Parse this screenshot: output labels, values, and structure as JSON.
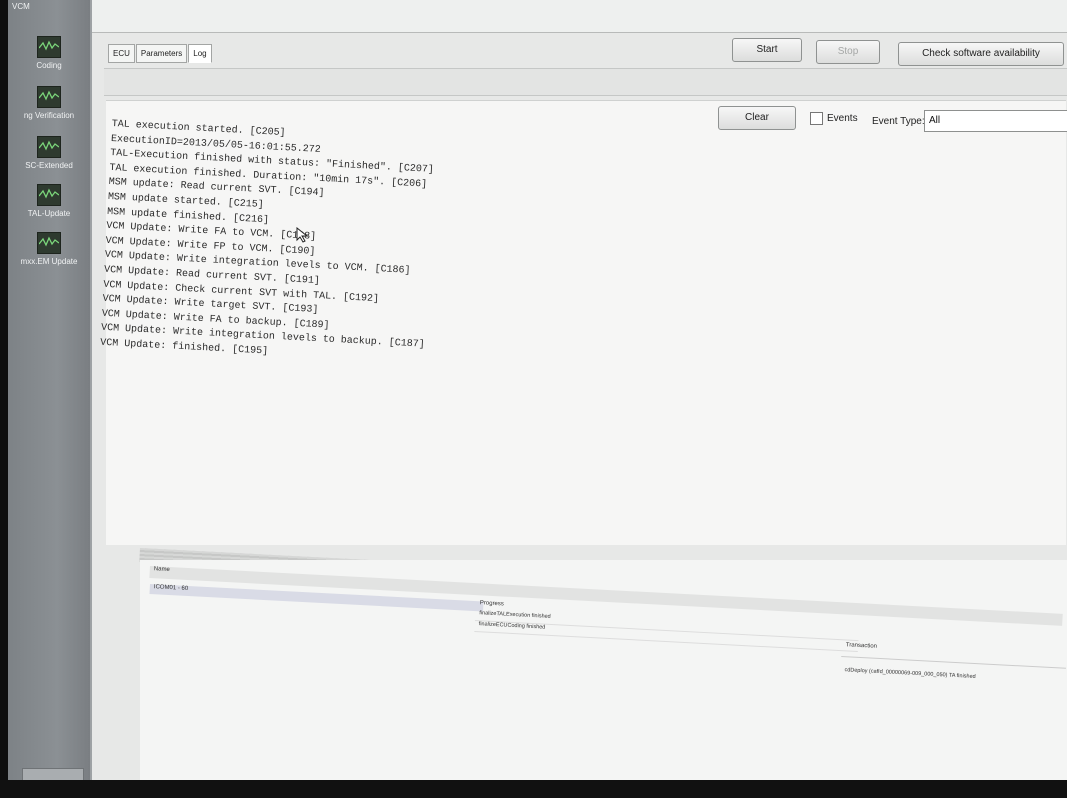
{
  "sidebar": {
    "items": [
      {
        "label": "VCM"
      },
      {
        "label": "Coding"
      },
      {
        "label": "ng Verification"
      },
      {
        "label": "SC-Extended"
      },
      {
        "label": "TAL-Update"
      },
      {
        "label": "mxx.EM Update"
      }
    ]
  },
  "tabs": [
    {
      "label": "ECU"
    },
    {
      "label": "Parameters"
    },
    {
      "label": "Log"
    }
  ],
  "toolbar": {
    "start_label": "Start",
    "stop_label": "Stop",
    "check_label": "Check software availability"
  },
  "log_toolbar": {
    "clear_label": "Clear",
    "events_label": "Events",
    "event_type_label": "Event Type:",
    "event_type_value": "All"
  },
  "log": {
    "lines": [
      "TAL execution started. [C205]",
      "ExecutionID=2013/05/05-16:01:55.272",
      "TAL-Execution finished with status: \"Finished\". [C207]",
      "TAL execution finished. Duration: \"10min 17s\". [C206]",
      "MSM update: Read current SVT. [C194]",
      "MSM update started. [C215]",
      "MSM update finished. [C216]",
      "VCM Update: Write FA to VCM. [C188]",
      "VCM Update: Write FP to VCM. [C190]",
      "VCM Update: Write integration levels to VCM. [C186]",
      "VCM Update: Read current SVT. [C191]",
      "VCM Update: Check current SVT with TAL. [C192]",
      "VCM Update: Write target SVT. [C193]",
      "VCM Update: Write FA to backup. [C189]",
      "VCM Update: Write integration levels to backup. [C187]",
      "VCM Update: finished. [C195]"
    ]
  },
  "bottom": {
    "name_header": "Name",
    "name_row": "ICOM01 - 60",
    "progress_header": "Progress",
    "progress_items": [
      "finalizeTALExecution finished",
      "finalizeECUCoding finished"
    ],
    "transaction_header": "Transaction",
    "transaction_item": "cdDeploy (cafId_00000069-009_000_050) TA finished"
  }
}
